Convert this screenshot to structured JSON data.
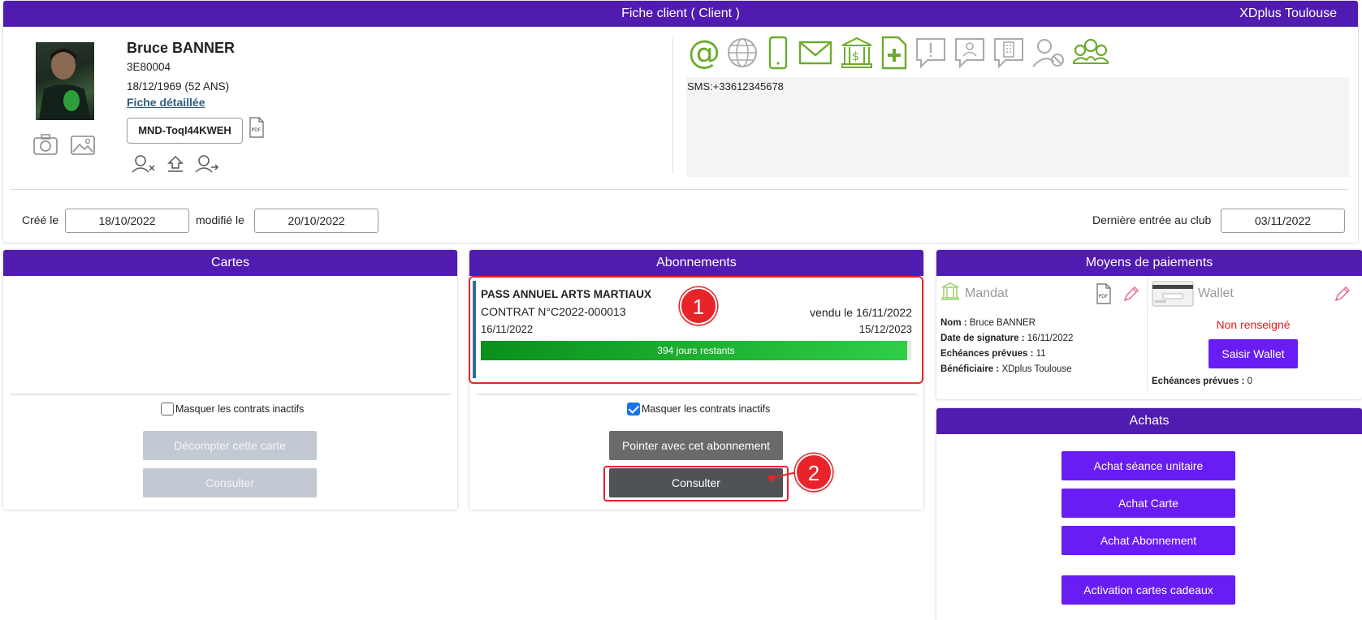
{
  "header": {
    "title": "Fiche client ( Client )",
    "club": "XDplus Toulouse"
  },
  "client": {
    "name": "Bruce BANNER",
    "code": "3E80004",
    "birth": "18/12/1969 (52 ANS)",
    "detail_link": "Fiche détaillée",
    "mandate_ref": "MND-ToqI44KWEH",
    "pdf_icon": "pdf-file-icon",
    "sms": "SMS:+33612345678"
  },
  "dates": {
    "created_label": "Créé le",
    "created": "18/10/2022",
    "modified_label": "modifié le",
    "modified": "20/10/2022",
    "last_entry_label": "Dernière entrée au club",
    "last_entry": "03/11/2022"
  },
  "cartes": {
    "title": "Cartes",
    "hide_label": "Masquer les contrats inactifs",
    "hide_checked": false,
    "btn_decompter": "Décompter cette carte",
    "btn_consulter": "Consulter"
  },
  "abonnements": {
    "title": "Abonnements",
    "contract": {
      "name": "PASS ANNUEL ARTS MARTIAUX",
      "number": "CONTRAT N°C2022-000013",
      "sold": "vendu le 16/11/2022",
      "start": "16/11/2022",
      "end": "15/12/2023",
      "remaining": "394 jours restants",
      "progress_fraction": 0.99
    },
    "hide_label": "Masquer les contrats inactifs",
    "hide_checked": true,
    "btn_pointer": "Pointer avec cet abonnement",
    "btn_consulter": "Consulter"
  },
  "paiements": {
    "title": "Moyens de paiements",
    "mandat": {
      "title": "Mandat",
      "nom_label": "Nom :",
      "nom": "Bruce BANNER",
      "date_label": "Date de signature :",
      "date": "16/11/2022",
      "echeances_label": "Echéances prévues :",
      "echeances": "11",
      "benef_label": "Bénéficiaire :",
      "benef": "XDplus Toulouse"
    },
    "wallet": {
      "title": "Wallet",
      "status": "Non renseigné",
      "btn": "Saisir Wallet",
      "echeances_label": "Echéances prévues :",
      "echeances": "0"
    }
  },
  "achats": {
    "title": "Achats",
    "btn_seance": "Achat séance unitaire",
    "btn_carte": "Achat Carte",
    "btn_abonnement": "Achat Abonnement",
    "btn_cadeaux": "Activation cartes cadeaux"
  },
  "annotations": {
    "one": "1",
    "two": "2"
  },
  "colors": {
    "header": "#4f1bb0",
    "button_purple": "#6a1df2",
    "icon_green": "#6cab2e",
    "icon_gray": "#aaaaaa",
    "progress": "#1fa82d",
    "alert": "#e8242a"
  }
}
